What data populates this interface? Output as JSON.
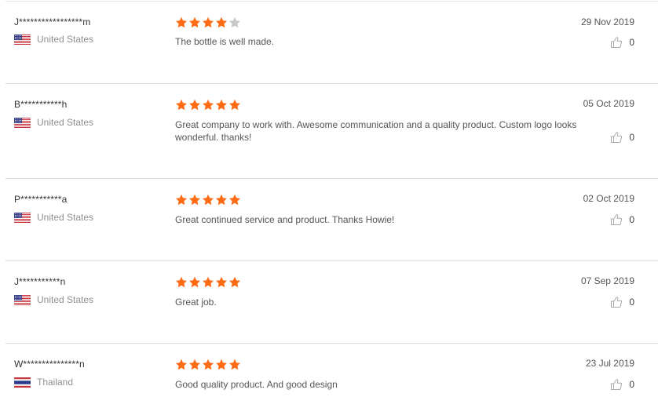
{
  "colors": {
    "star_filled": "#ff6a14",
    "star_empty": "#c8c8c8",
    "divider": "#dedede"
  },
  "reviews": [
    {
      "user": "J*****************m",
      "country": "United States",
      "flag": "us-flag-icon",
      "rating": 4,
      "text": "The bottle is well made.",
      "date": "29 Nov 2019",
      "likes": "0"
    },
    {
      "user": "B***********h",
      "country": "United States",
      "flag": "us-flag-icon",
      "rating": 5,
      "text": "Great company to work with.  Awesome communication and a quality product. Custom logo looks wonderful.  thanks!",
      "date": "05 Oct 2019",
      "likes": "0"
    },
    {
      "user": "P***********a",
      "country": "United States",
      "flag": "us-flag-icon",
      "rating": 5,
      "text": "Great continued service and product. Thanks Howie!",
      "date": "02 Oct 2019",
      "likes": "0"
    },
    {
      "user": "J***********n",
      "country": "United States",
      "flag": "us-flag-icon",
      "rating": 5,
      "text": "Great job.",
      "date": "07 Sep 2019",
      "likes": "0"
    },
    {
      "user": "W***************n",
      "country": "Thailand",
      "flag": "thailand-flag-icon",
      "rating": 5,
      "text": "Good quality product. And good design",
      "date": "23 Jul 2019",
      "likes": "0"
    }
  ]
}
